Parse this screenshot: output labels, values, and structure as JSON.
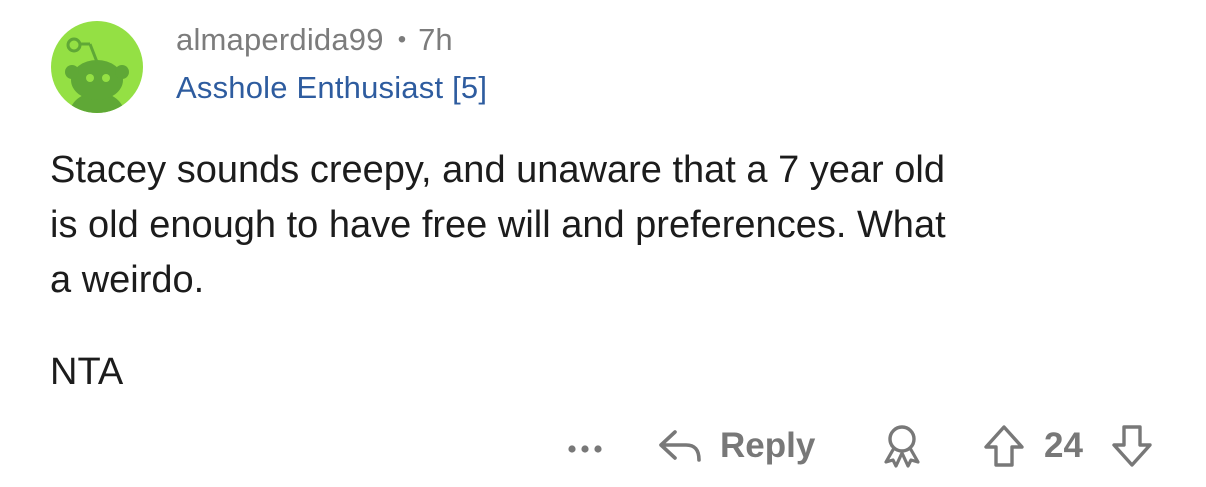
{
  "comment": {
    "author": "almaperdida99",
    "separator": "•",
    "time": "7h",
    "flair": "Asshole Enthusiast [5]",
    "body_lines": [
      "Stacey sounds creepy, and unaware that a 7 year old",
      "is old enough to have free will and preferences. What",
      "a weirdo."
    ],
    "verdict": "NTA"
  },
  "actions": {
    "more_icon": "more-dots-icon",
    "reply_icon": "reply-arrow-icon",
    "reply_label": "Reply",
    "award_icon": "award-icon",
    "upvote_icon": "upvote-arrow-icon",
    "score": "24",
    "downvote_icon": "downvote-arrow-icon"
  },
  "colors": {
    "avatar_bg": "#94E044",
    "avatar_figure": "#5FA836",
    "meta_text": "#7C7C7C",
    "flair_text": "#2E5C9F",
    "body_text": "#1C1C1C",
    "action_text": "#787878"
  }
}
